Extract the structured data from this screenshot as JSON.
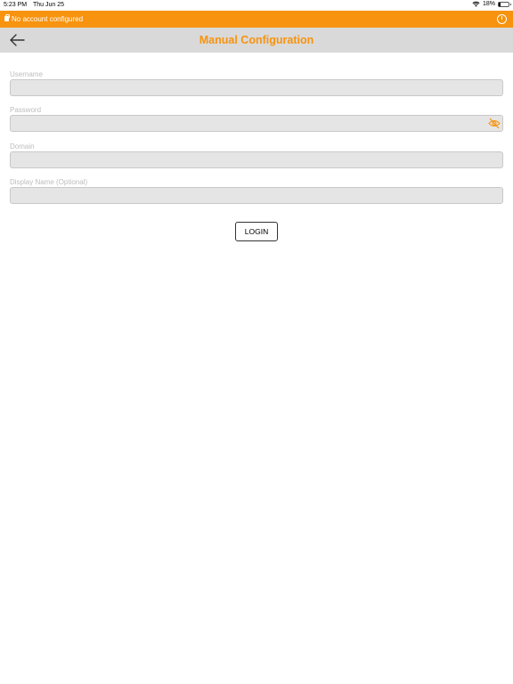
{
  "status_bar": {
    "time": "5:23 PM",
    "date": "Thu Jun 25",
    "battery_percent": "18%",
    "battery_level": 0.18,
    "wifi_icon": "wifi-icon"
  },
  "banner": {
    "text": "No account configured",
    "color": "#f7930f"
  },
  "header": {
    "title": "Manual Configuration",
    "back_icon": "arrow-left-icon",
    "background": "#d9d9d9"
  },
  "form": {
    "username": {
      "label": "Username",
      "value": ""
    },
    "password": {
      "label": "Password",
      "value": "",
      "toggle_icon": "eye-slash-icon"
    },
    "domain": {
      "label": "Domain",
      "value": ""
    },
    "display_name": {
      "label": "Display Name (Optional)",
      "value": ""
    }
  },
  "login_button": {
    "label": "LOGIN"
  }
}
